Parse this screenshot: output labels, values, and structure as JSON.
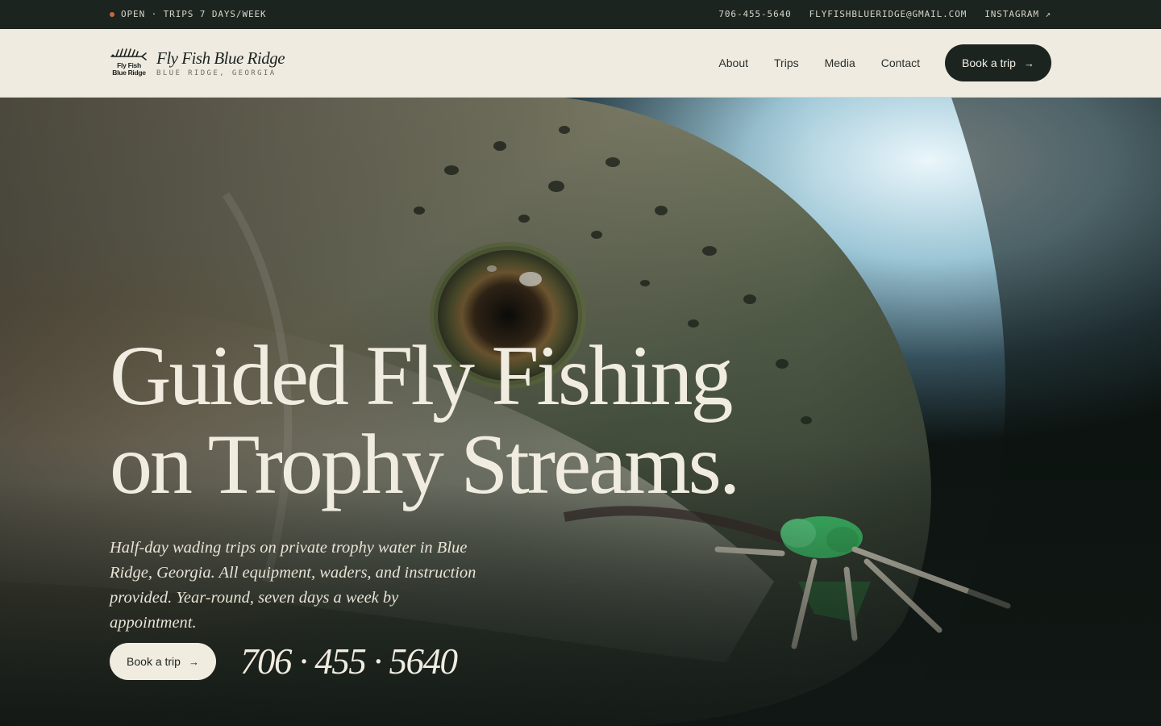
{
  "topbar": {
    "status": "OPEN · TRIPS 7 DAYS/WEEK",
    "phone": "706-455-5640",
    "email": "FLYFISHBLUERIDGE@GMAIL.COM",
    "instagram": "INSTAGRAM ↗"
  },
  "brand": {
    "logo_line1": "Fly Fish",
    "logo_line2": "Blue Ridge",
    "name": "Fly Fish Blue Ridge",
    "location": "BLUE RIDGE, GEORGIA"
  },
  "nav": {
    "items": [
      "About",
      "Trips",
      "Media",
      "Contact"
    ],
    "cta": "Book a trip",
    "cta_icon": "→"
  },
  "hero": {
    "headline_line1": "Guided Fly Fishing",
    "headline_line2": "on Trophy Streams.",
    "subcopy": "Half-day wading trips on private trophy water in Blue Ridge, Georgia. All equipment, waders, and instruction provided. Year-round, seven days a week by appointment.",
    "cta": "Book a trip",
    "cta_icon": "→",
    "phone": "706 · 455 · 5640"
  },
  "colors": {
    "dark": "#1c2420",
    "cream": "#efebe1",
    "accent_dot": "#c9683c",
    "fly_green": "#3fc46a"
  },
  "icons": {
    "logo": "fish-skeleton-logo-icon",
    "status": "status-dot-icon",
    "external": "arrow-up-right-icon",
    "cta": "arrow-right-icon"
  }
}
